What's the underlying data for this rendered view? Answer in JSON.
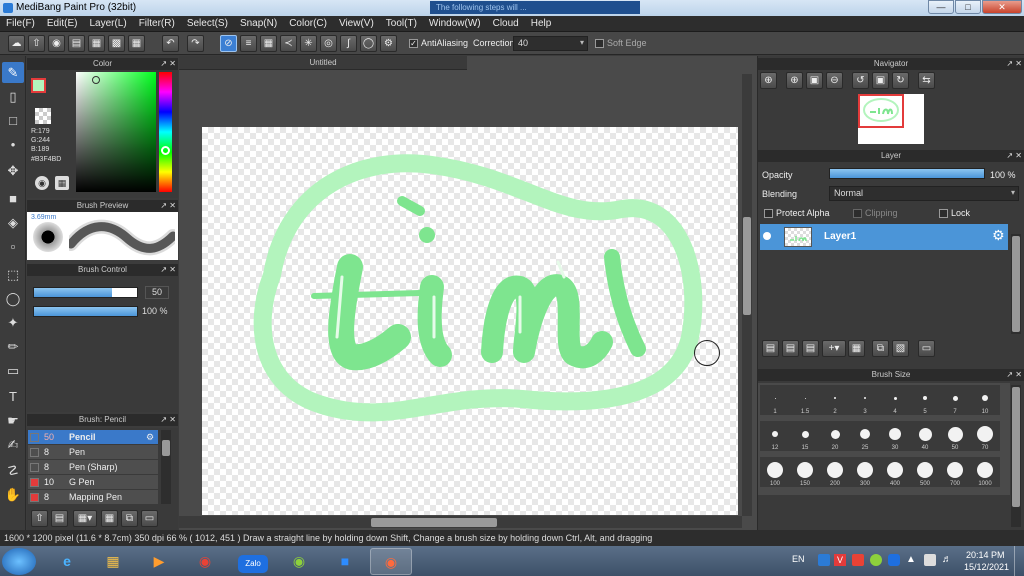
{
  "window": {
    "title": "MediBang Paint Pro (32bit)",
    "background_notice": "The following steps will ..."
  },
  "menu": [
    "File(F)",
    "Edit(E)",
    "Layer(L)",
    "Filter(R)",
    "Select(S)",
    "Snap(N)",
    "Color(C)",
    "View(V)",
    "Tool(T)",
    "Window(W)",
    "Cloud",
    "Help"
  ],
  "options": {
    "antialiasing_label": "AntiAliasing",
    "antialiasing_checked": true,
    "correction_label": "Correction",
    "correction_value": "40",
    "softedge_label": "Soft Edge",
    "softedge_checked": false
  },
  "color_panel": {
    "title": "Color",
    "rgb": {
      "r": "R:179",
      "g": "G:244",
      "b": "B:189"
    },
    "hex": "#B3F4BD",
    "current_color": "#B3F4BD"
  },
  "brush_preview": {
    "title": "Brush Preview",
    "size_label": "3.69mm"
  },
  "brush_control": {
    "title": "Brush Control",
    "size_value": "50",
    "size_fraction": 0.76,
    "opacity_value": "100 %",
    "opacity_fraction": 1.0
  },
  "brush_list": {
    "title": "Brush: Pencil",
    "items": [
      {
        "size": "50",
        "name": "Pencil",
        "color": "#3a3a3a",
        "active": true
      },
      {
        "size": "8",
        "name": "Pen",
        "color": "#3a3a3a",
        "active": false
      },
      {
        "size": "8",
        "name": "Pen (Sharp)",
        "color": "#3a3a3a",
        "active": false
      },
      {
        "size": "10",
        "name": "G Pen",
        "color": "#e33b3b",
        "active": false
      },
      {
        "size": "8",
        "name": "Mapping Pen",
        "color": "#e33b3b",
        "active": false
      }
    ]
  },
  "document": {
    "tab_title": "Untitled"
  },
  "navigator": {
    "title": "Navigator"
  },
  "layer_panel": {
    "title": "Layer",
    "opacity_label": "Opacity",
    "opacity_value": "100 %",
    "opacity_fraction": 1.0,
    "blending_label": "Blending",
    "blending_value": "Normal",
    "protect_alpha_label": "Protect Alpha",
    "clipping_label": "Clipping",
    "lock_label": "Lock",
    "layers": [
      {
        "name": "Layer1",
        "visible": true
      }
    ]
  },
  "brush_size": {
    "title": "Brush Size",
    "sizes": [
      "1",
      "1.5",
      "2",
      "3",
      "4",
      "5",
      "7",
      "10",
      "12",
      "15",
      "20",
      "25",
      "30",
      "40",
      "50",
      "70",
      "100",
      "150",
      "200",
      "300",
      "400",
      "500",
      "700",
      "1000"
    ]
  },
  "status": {
    "text": "1600 * 1200 pixel   (11.6 * 8.7cm)   350 dpi   66 %   ( 1012, 451 )   Draw a straight line by holding down Shift, Change a brush size by holding down Ctrl, Alt, and dragging"
  },
  "taskbar": {
    "apps": [
      "Start",
      "Internet Explorer",
      "File Explorer",
      "Media Player",
      "Chrome",
      "Zalo",
      "Greenshot",
      "Zoom",
      "MediBang Paint Pro"
    ],
    "zalo_label": "Zalo",
    "language": "EN",
    "time": "20:14 PM",
    "date": "15/12/2021"
  },
  "accent_colors": {
    "selection": "#3a79c9",
    "stroke": "#7ee58f",
    "halo": "#b3f4bd"
  }
}
